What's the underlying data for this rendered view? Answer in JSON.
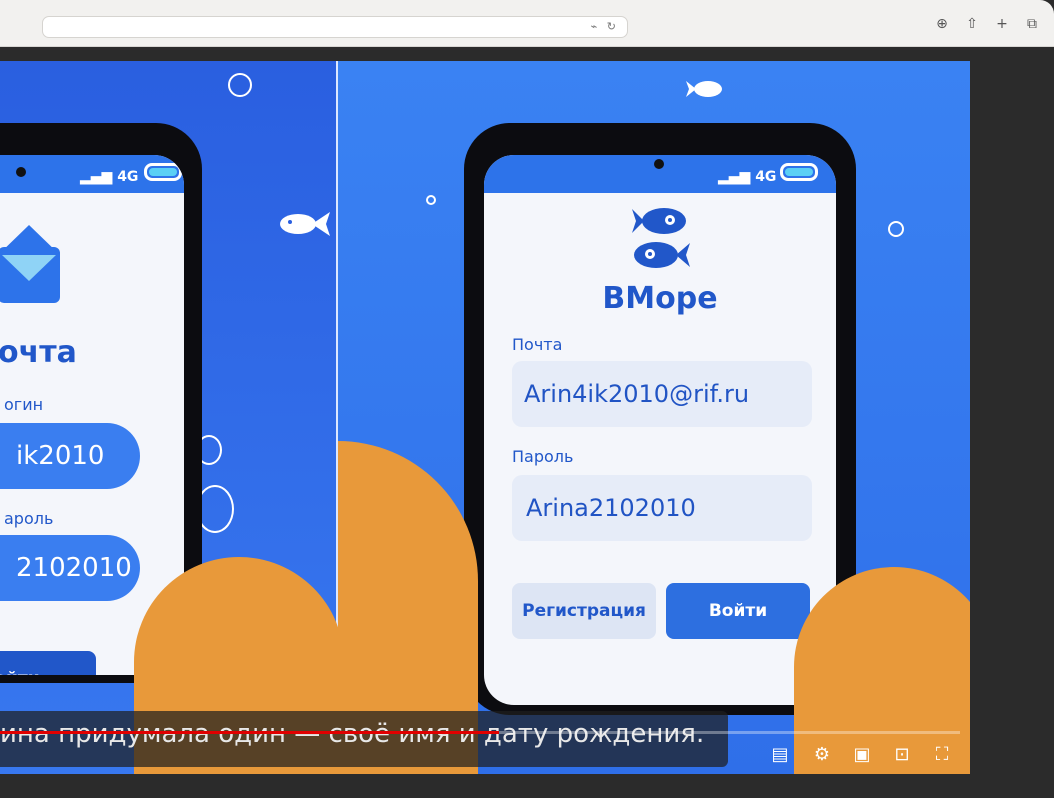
{
  "browser": {
    "address_icons": "⌁ ↻",
    "toolbar_icons": {
      "download": "⊕",
      "share": "⇧",
      "new_tab": "+",
      "tabs": "⧉"
    }
  },
  "video": {
    "left_app": {
      "signal_label": "4G",
      "title": "очта",
      "login_label": "огин",
      "login_value": "ik2010",
      "password_label": "ароль",
      "password_value": "2102010",
      "login_button": "ойти"
    },
    "right_app": {
      "signal_label": "4G",
      "title": "ВМоре",
      "email_label": "Почта",
      "email_value": "Arin4ik2010@rif.ru",
      "password_label": "Пароль",
      "password_value": "Arina2102010",
      "register_button": "Регистрация",
      "login_button": "Войти"
    },
    "caption": "ина придумала один — своё имя и дату рождения.",
    "progress_fraction": 0.52,
    "controls": {
      "subtitles": "▤",
      "settings": "⚙",
      "miniplayer": "▣",
      "airplay": "⊡",
      "fullscreen": "⛶"
    }
  },
  "colors": {
    "accent": "#2157c9",
    "video_blue": "#2f6fe9",
    "blob_orange": "#e8993a",
    "progress_red": "#e00000"
  }
}
